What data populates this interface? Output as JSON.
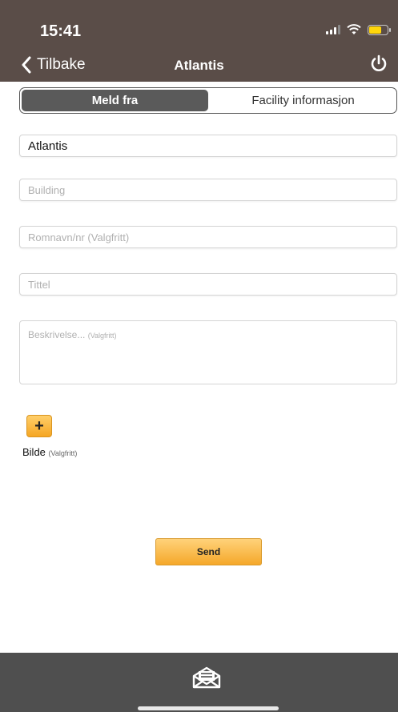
{
  "status_bar": {
    "time": "15:41"
  },
  "nav": {
    "back_label": "Tilbake",
    "title": "Atlantis"
  },
  "segment": {
    "tab_report": "Meld fra",
    "tab_facility": "Facility informasjon"
  },
  "form": {
    "location_value": "Atlantis",
    "building_placeholder": "Building",
    "room_placeholder": "Romnavn/nr (Valgfritt)",
    "title_placeholder": "Tittel",
    "description_placeholder": "Beskrivelse...",
    "description_optional": "(Valgfritt)"
  },
  "image": {
    "add_symbol": "+",
    "label": "Bilde",
    "optional": "(Valgfritt)"
  },
  "actions": {
    "send_label": "Send"
  },
  "colors": {
    "header": "#5a4d48",
    "accent": "#f5a623",
    "bottom_bar": "#4f4f4f"
  }
}
